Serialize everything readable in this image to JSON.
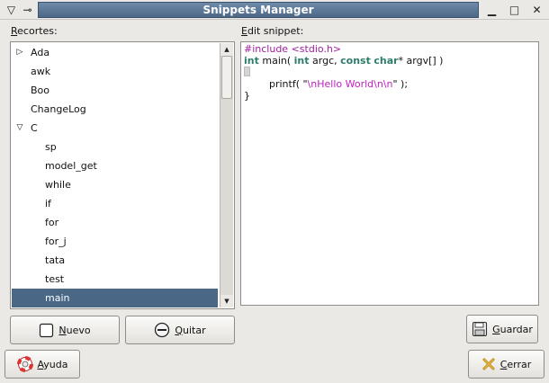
{
  "window": {
    "title": "Snippets Manager",
    "menu_glyph": "▽",
    "pin_glyph": "⊸",
    "minimize_glyph": "▁",
    "maximize_glyph": "□",
    "close_glyph": "✕"
  },
  "left": {
    "label_mnemonic": "R",
    "label_rest": "ecortes:",
    "tree": [
      {
        "label": "Ada",
        "level": 0,
        "expander": "collapsed"
      },
      {
        "label": "awk",
        "level": 0,
        "expander": "none"
      },
      {
        "label": "Boo",
        "level": 0,
        "expander": "none"
      },
      {
        "label": "ChangeLog",
        "level": 0,
        "expander": "none"
      },
      {
        "label": "C",
        "level": 0,
        "expander": "expanded"
      },
      {
        "label": "sp",
        "level": 1,
        "expander": "none"
      },
      {
        "label": "model_get",
        "level": 1,
        "expander": "none"
      },
      {
        "label": "while",
        "level": 1,
        "expander": "none"
      },
      {
        "label": "if",
        "level": 1,
        "expander": "none"
      },
      {
        "label": "for",
        "level": 1,
        "expander": "none"
      },
      {
        "label": "for_j",
        "level": 1,
        "expander": "none"
      },
      {
        "label": "tata",
        "level": 1,
        "expander": "none"
      },
      {
        "label": "test",
        "level": 1,
        "expander": "none"
      },
      {
        "label": "main",
        "level": 1,
        "expander": "none",
        "selected": true
      }
    ]
  },
  "right": {
    "label_mnemonic": "E",
    "label_rest": "dit snippet:",
    "code": {
      "line1_pre": "#include ",
      "line1_inc": "<stdio.h>",
      "line2_kw1": "int",
      "line2_a": " main( ",
      "line2_kw2": "int",
      "line2_b": " argc, ",
      "line2_kw3": "const",
      "line2_sp": " ",
      "line2_kw4": "char",
      "line2_c": "* argv[] )",
      "line4_a": "        printf( \"",
      "line4_str": "\\nHello World\\n\\n",
      "line4_b": "\" );",
      "line5": "}"
    }
  },
  "buttons": {
    "nuevo_mnemonic": "N",
    "nuevo_rest": "uevo",
    "quitar_mnemonic": "Q",
    "quitar_rest": "uitar",
    "guardar_mnemonic": "G",
    "guardar_rest": "uardar",
    "ayuda_mnemonic": "A",
    "ayuda_rest": "yuda",
    "cerrar_mnemonic": "C",
    "cerrar_rest": "errar"
  },
  "colors": {
    "title_bar": "#4d6887",
    "selection": "#4a6785",
    "preprocessor": "#a020a0",
    "keyword": "#2e7d6b",
    "string": "#c020c0"
  }
}
